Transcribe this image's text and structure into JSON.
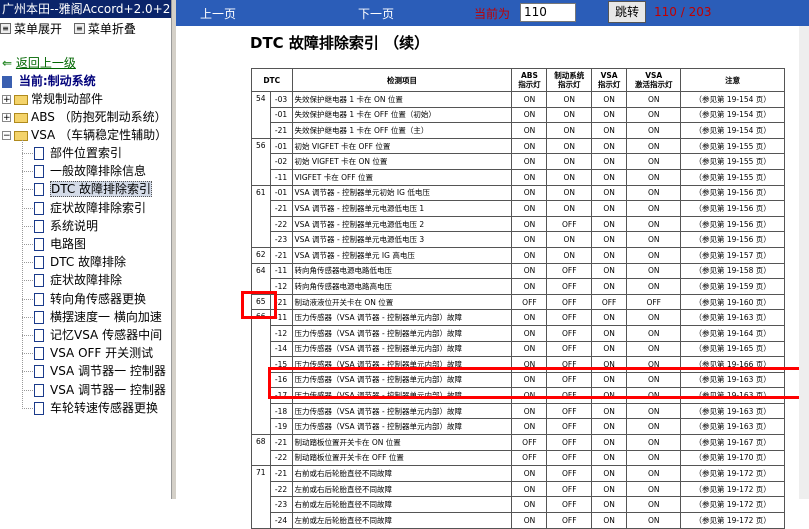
{
  "window": {
    "title": "广州本田--雅阁Accord+2.0+2.4"
  },
  "menu": {
    "expand": "菜单展开",
    "collapse": "菜单折叠"
  },
  "tree": {
    "back": "返回上一级",
    "current": "当前:制动系统",
    "folders": [
      "常规制动部件",
      "ABS （防抱死制动系统）",
      "VSA （车辆稳定性辅助）"
    ],
    "items": [
      "部件位置索引",
      "一般故障排除信息",
      "DTC 故障排除索引",
      "症状故障排除索引",
      "系统说明",
      "电路图",
      "DTC 故障排除",
      "症状故障排除",
      "转向角传感器更换",
      "横摆速度一 横向加速",
      "记忆VSA 传感器中间",
      "VSA OFF 开关测试",
      "VSA 调节器一 控制器",
      "VSA 调节器一 控制器",
      "车轮转速传感器更换"
    ],
    "selected_index": 2
  },
  "toolbar": {
    "prev": "上一页",
    "next": "下一页",
    "current_label": "当前为",
    "current_value": "110",
    "go": "跳转",
    "page_info": "110 / 203"
  },
  "document": {
    "title": "DTC 故障排除索引 （续）",
    "headers": [
      "DTC",
      "",
      "检测项目",
      "ABS\n指示灯",
      "制动系统\n指示灯",
      "VSA\n指示灯",
      "VSA\n激活指示灯",
      "注意"
    ],
    "rows": [
      [
        "54",
        "-03",
        "失效保护继电器 1 卡在 ON 位置",
        "ON",
        "ON",
        "ON",
        "ON",
        "（参见第 19-154 页）"
      ],
      [
        "",
        "-01",
        "失效保护继电器 1 卡在 OFF 位置（初始）",
        "ON",
        "ON",
        "ON",
        "ON",
        "（参见第 19-154 页）"
      ],
      [
        "",
        "-21",
        "失效保护继电器 1 卡在 OFF 位置（主）",
        "ON",
        "ON",
        "ON",
        "ON",
        "（参见第 19-154 页）"
      ],
      [
        "56",
        "-01",
        "初始 VIGFET 卡在 OFF 位置",
        "ON",
        "ON",
        "ON",
        "ON",
        "（参见第 19-155 页）"
      ],
      [
        "",
        "-02",
        "初始 VIGFET 卡在 ON 位置",
        "ON",
        "ON",
        "ON",
        "ON",
        "（参见第 19-155 页）"
      ],
      [
        "",
        "-11",
        "VIGFET 卡在 OFF 位置",
        "ON",
        "ON",
        "ON",
        "ON",
        "（参见第 19-155 页）"
      ],
      [
        "61",
        "-01",
        "VSA 调节器 - 控制器单元初始 IG 低电压",
        "ON",
        "ON",
        "ON",
        "ON",
        "（参见第 19-156 页）"
      ],
      [
        "",
        "-21",
        "VSA 调节器 - 控制器单元电源低电压 1",
        "ON",
        "ON",
        "ON",
        "ON",
        "（参见第 19-156 页）"
      ],
      [
        "",
        "-22",
        "VSA 调节器 - 控制器单元电源低电压 2",
        "ON",
        "OFF",
        "ON",
        "ON",
        "（参见第 19-156 页）"
      ],
      [
        "",
        "-23",
        "VSA 调节器 - 控制器单元电源低电压 3",
        "ON",
        "ON",
        "ON",
        "ON",
        "（参见第 19-156 页）"
      ],
      [
        "62",
        "-21",
        "VSA 调节器 - 控制器单元 IG 高电压",
        "ON",
        "ON",
        "ON",
        "ON",
        "（参见第 19-157 页）"
      ],
      [
        "64",
        "-11",
        "转向角传感器电源电路低电压",
        "ON",
        "OFF",
        "ON",
        "ON",
        "（参见第 19-158 页）"
      ],
      [
        "",
        "-12",
        "转向角传感器电源电路高电压",
        "ON",
        "OFF",
        "ON",
        "ON",
        "（参见第 19-159 页）"
      ],
      [
        "65",
        "-21",
        "制动液液位开关卡在 ON 位置",
        "OFF",
        "OFF",
        "OFF",
        "OFF",
        "（参见第 19-160 页）"
      ],
      [
        "66",
        "-11",
        "压力传感器（VSA 调节器 - 控制器单元内部）故障",
        "ON",
        "OFF",
        "ON",
        "ON",
        "（参见第 19-163 页）"
      ],
      [
        "",
        "-12",
        "压力传感器（VSA 调节器 - 控制器单元内部）故障",
        "ON",
        "OFF",
        "ON",
        "ON",
        "（参见第 19-164 页）"
      ],
      [
        "",
        "-14",
        "压力传感器（VSA 调节器 - 控制器单元内部）故障",
        "ON",
        "OFF",
        "ON",
        "ON",
        "（参见第 19-165 页）"
      ],
      [
        "",
        "-15",
        "压力传感器（VSA 调节器 - 控制器单元内部）故障",
        "ON",
        "OFF",
        "ON",
        "ON",
        "（参见第 19-166 页）"
      ],
      [
        "",
        "-16",
        "压力传感器（VSA 调节器 - 控制器单元内部）故障",
        "ON",
        "OFF",
        "ON",
        "ON",
        "（参见第 19-163 页）"
      ],
      [
        "",
        "-17",
        "压力传感器（VSA 调节器 - 控制器单元内部）故障",
        "ON",
        "OFF",
        "ON",
        "ON",
        "（参见第 19-163 页）"
      ],
      [
        "",
        "-18",
        "压力传感器（VSA 调节器 - 控制器单元内部）故障",
        "ON",
        "OFF",
        "ON",
        "ON",
        "（参见第 19-163 页）"
      ],
      [
        "",
        "-19",
        "压力传感器（VSA 调节器 - 控制器单元内部）故障",
        "ON",
        "OFF",
        "ON",
        "ON",
        "（参见第 19-163 页）"
      ],
      [
        "68",
        "-21",
        "制动踏板位置开关卡在 ON 位置",
        "OFF",
        "OFF",
        "ON",
        "ON",
        "（参见第 19-167 页）"
      ],
      [
        "",
        "-22",
        "制动踏板位置开关卡在 OFF 位置",
        "OFF",
        "OFF",
        "ON",
        "ON",
        "（参见第 19-170 页）"
      ],
      [
        "71",
        "-21",
        "右前或右后轮胎直径不同故障",
        "ON",
        "OFF",
        "ON",
        "ON",
        "（参见第 19-172 页）"
      ],
      [
        "",
        "-22",
        "左前或右后轮胎直径不同故障",
        "ON",
        "OFF",
        "ON",
        "ON",
        "（参见第 19-172 页）"
      ],
      [
        "",
        "-23",
        "右前或左后轮胎直径不同故障",
        "ON",
        "OFF",
        "ON",
        "ON",
        "（参见第 19-172 页）"
      ],
      [
        "",
        "-24",
        "左前或左后轮胎直径不同故障",
        "ON",
        "OFF",
        "ON",
        "ON",
        "（参见第 19-172 页）"
      ]
    ]
  },
  "colors": {
    "toolbar_bg": "#2b5db8",
    "highlight": "#ff0000",
    "titlebar_bg": "#0a246a"
  }
}
